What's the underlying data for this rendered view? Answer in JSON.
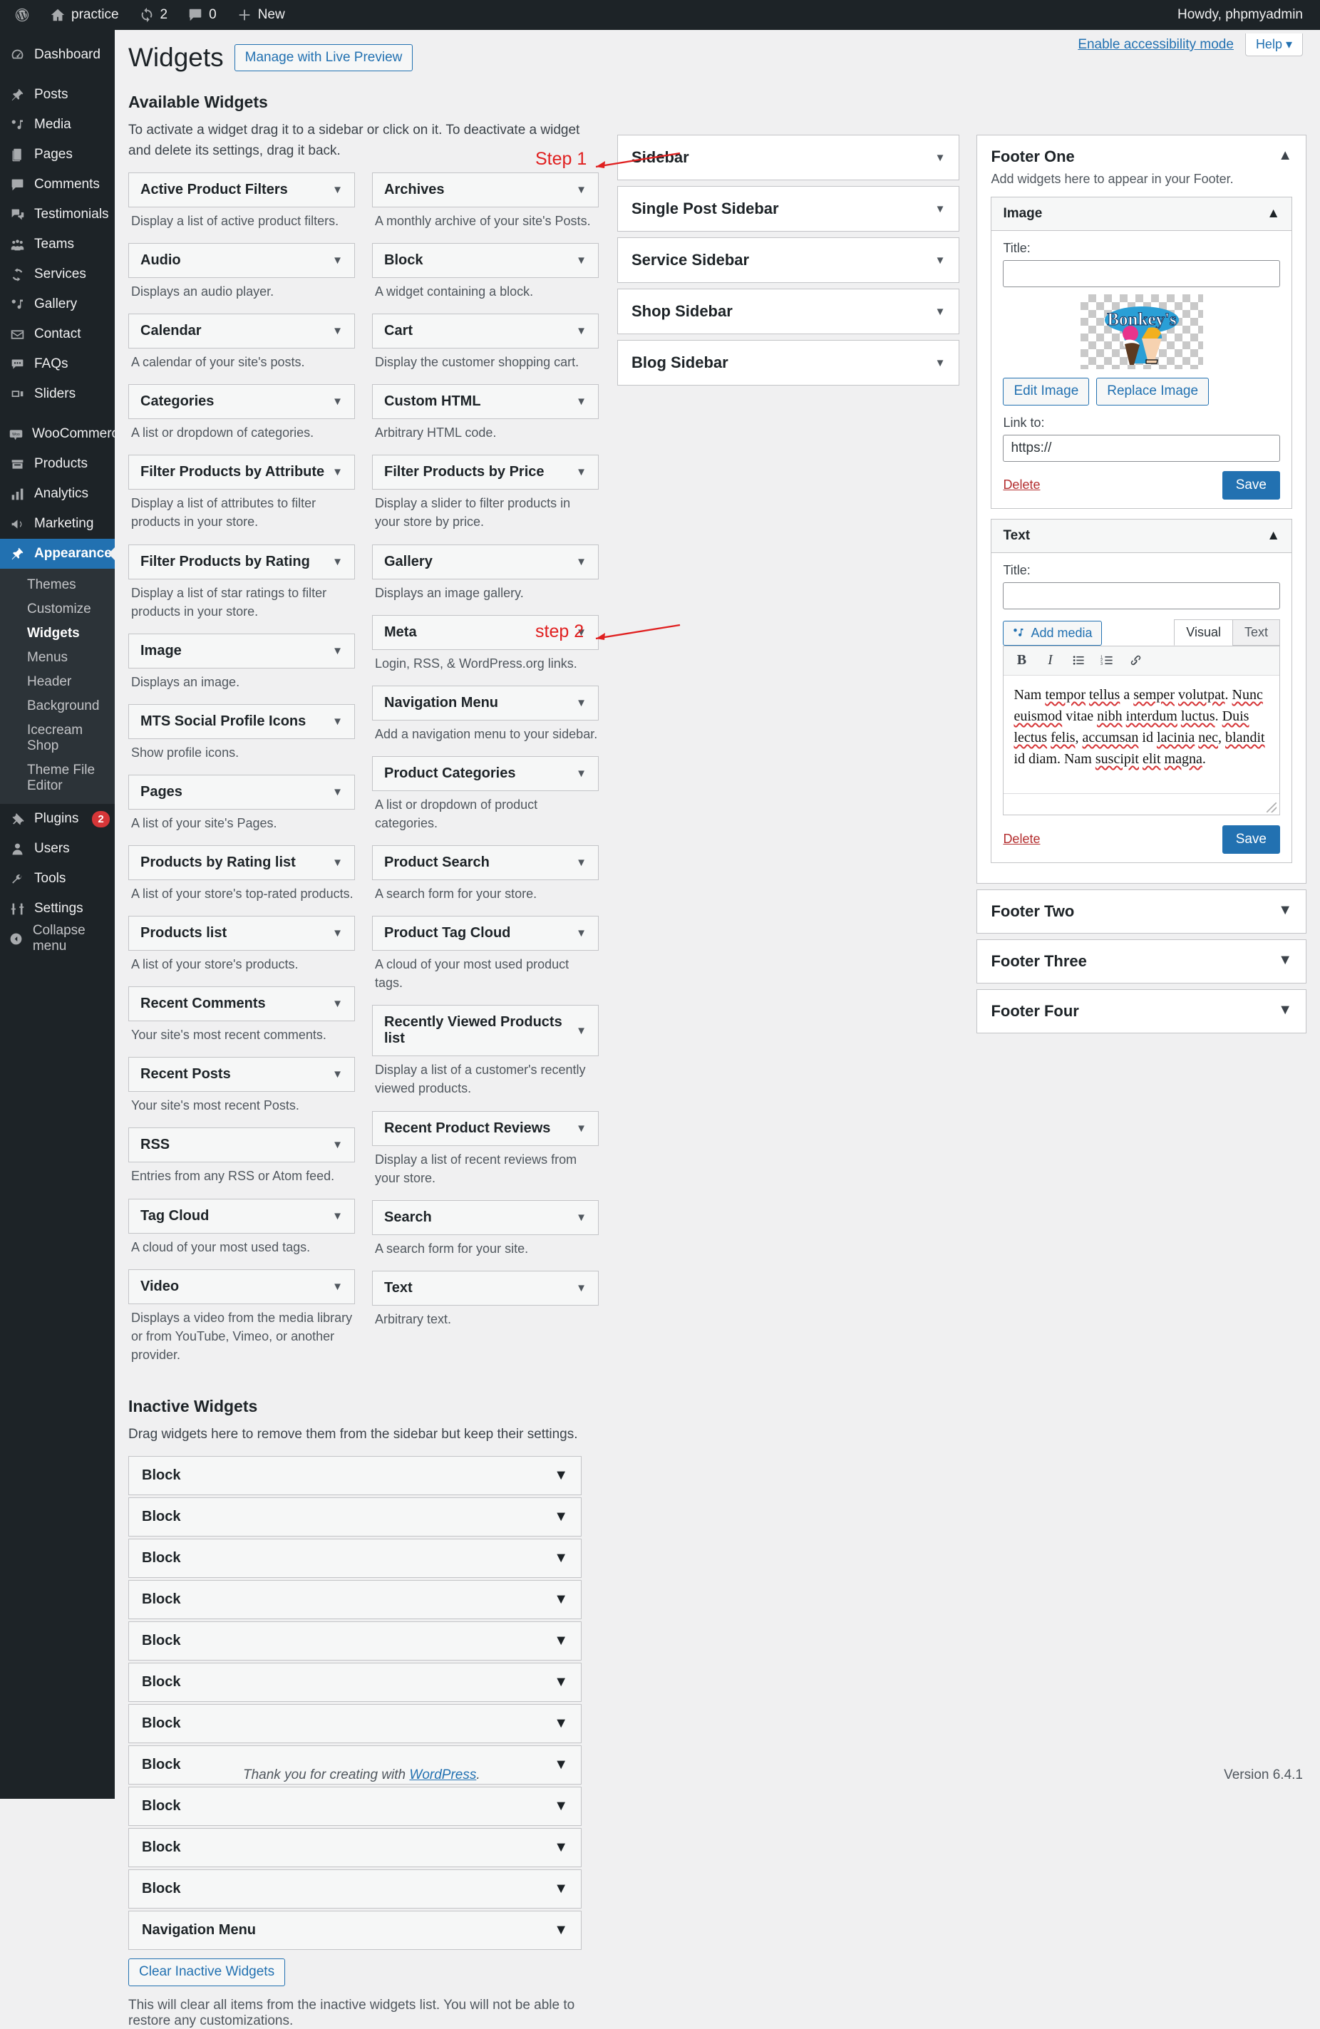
{
  "adminbar": {
    "logo_icon": "wordpress-icon",
    "site_icon": "home-icon",
    "site_name": "practice",
    "updates_icon": "updates-icon",
    "updates_count": "2",
    "comments_icon": "comment-icon",
    "comments_count": "0",
    "new_icon": "plus-icon",
    "new_label": "New",
    "howdy": "Howdy, phpmyadmin"
  },
  "adminmenu": {
    "items": [
      {
        "label": "Dashboard",
        "icon": "dashboard-icon"
      },
      {
        "label": "Posts",
        "icon": "pin-icon"
      },
      {
        "label": "Media",
        "icon": "media-icon"
      },
      {
        "label": "Pages",
        "icon": "pages-icon"
      },
      {
        "label": "Comments",
        "icon": "comment-icon"
      },
      {
        "label": "Testimonials",
        "icon": "testimonial-icon"
      },
      {
        "label": "Teams",
        "icon": "teams-icon"
      },
      {
        "label": "Services",
        "icon": "services-icon"
      },
      {
        "label": "Gallery",
        "icon": "gallery-icon"
      },
      {
        "label": "Contact",
        "icon": "envelope-icon"
      },
      {
        "label": "FAQs",
        "icon": "faq-icon"
      },
      {
        "label": "Sliders",
        "icon": "sliders-icon"
      },
      {
        "label": "WooCommerce",
        "icon": "woocommerce-icon"
      },
      {
        "label": "Products",
        "icon": "products-icon"
      },
      {
        "label": "Analytics",
        "icon": "analytics-icon"
      },
      {
        "label": "Marketing",
        "icon": "marketing-icon"
      },
      {
        "label": "Appearance",
        "icon": "appearance-icon"
      }
    ],
    "appearance_submenu": [
      "Themes",
      "Customize",
      "Widgets",
      "Menus",
      "Header",
      "Background",
      "Icecream Shop",
      "Theme File Editor"
    ],
    "appearance_active_sub": "Widgets",
    "plugins": {
      "label": "Plugins",
      "icon": "plugins-icon",
      "badge": "2"
    },
    "users": {
      "label": "Users",
      "icon": "users-icon"
    },
    "tools": {
      "label": "Tools",
      "icon": "tools-icon"
    },
    "settings": {
      "label": "Settings",
      "icon": "settings-icon"
    },
    "collapse": {
      "label": "Collapse menu",
      "icon": "collapse-icon"
    }
  },
  "topbar": {
    "accessibility_link": "Enable accessibility mode",
    "help_label": "Help ▾"
  },
  "page": {
    "title": "Widgets",
    "live_preview_button": "Manage with Live Preview",
    "available_heading": "Available Widgets",
    "available_desc": "To activate a widget drag it to a sidebar or click on it. To deactivate a widget and delete its settings, drag it back.",
    "inactive_heading": "Inactive Widgets",
    "inactive_desc": "Drag widgets here to remove them from the sidebar but keep their settings.",
    "clear_button": "Clear Inactive Widgets",
    "clear_note": "This will clear all items from the inactive widgets list. You will not be able to restore any customizations.",
    "credit_prefix": "Thank you for creating with ",
    "credit_link": "WordPress",
    "credit_suffix": ".",
    "version": "Version 6.4.1"
  },
  "available_widgets": {
    "column_left": [
      {
        "name": "Active Product Filters",
        "desc": "Display a list of active product filters."
      },
      {
        "name": "Audio",
        "desc": "Displays an audio player."
      },
      {
        "name": "Calendar",
        "desc": "A calendar of your site's posts."
      },
      {
        "name": "Categories",
        "desc": "A list or dropdown of categories."
      },
      {
        "name": "Filter Products by Attribute",
        "desc": "Display a list of attributes to filter products in your store."
      },
      {
        "name": "Filter Products by Rating",
        "desc": "Display a list of star ratings to filter products in your store."
      },
      {
        "name": "Image",
        "desc": "Displays an image."
      },
      {
        "name": "MTS Social Profile Icons",
        "desc": "Show profile icons."
      },
      {
        "name": "Pages",
        "desc": "A list of your site's Pages."
      },
      {
        "name": "Products by Rating list",
        "desc": "A list of your store's top-rated products."
      },
      {
        "name": "Products list",
        "desc": "A list of your store's products."
      },
      {
        "name": "Recent Comments",
        "desc": "Your site's most recent comments."
      },
      {
        "name": "Recent Posts",
        "desc": "Your site's most recent Posts."
      },
      {
        "name": "RSS",
        "desc": "Entries from any RSS or Atom feed."
      },
      {
        "name": "Tag Cloud",
        "desc": "A cloud of your most used tags."
      },
      {
        "name": "Video",
        "desc": "Displays a video from the media library or from YouTube, Vimeo, or another provider."
      }
    ],
    "column_right": [
      {
        "name": "Archives",
        "desc": "A monthly archive of your site's Posts."
      },
      {
        "name": "Block",
        "desc": "A widget containing a block."
      },
      {
        "name": "Cart",
        "desc": "Display the customer shopping cart."
      },
      {
        "name": "Custom HTML",
        "desc": "Arbitrary HTML code."
      },
      {
        "name": "Filter Products by Price",
        "desc": "Display a slider to filter products in your store by price."
      },
      {
        "name": "Gallery",
        "desc": "Displays an image gallery."
      },
      {
        "name": "Meta",
        "desc": "Login, RSS, & WordPress.org links."
      },
      {
        "name": "Navigation Menu",
        "desc": "Add a navigation menu to your sidebar."
      },
      {
        "name": "Product Categories",
        "desc": "A list or dropdown of product categories."
      },
      {
        "name": "Product Search",
        "desc": "A search form for your store."
      },
      {
        "name": "Product Tag Cloud",
        "desc": "A cloud of your most used product tags."
      },
      {
        "name": "Recently Viewed Products list",
        "desc": "Display a list of a customer's recently viewed products."
      },
      {
        "name": "Recent Product Reviews",
        "desc": "Display a list of recent reviews from your store."
      },
      {
        "name": "Search",
        "desc": "A search form for your site."
      },
      {
        "name": "Text",
        "desc": "Arbitrary text."
      }
    ]
  },
  "sidebar_panels": [
    {
      "title": "Sidebar"
    },
    {
      "title": "Single Post Sidebar"
    },
    {
      "title": "Service Sidebar"
    },
    {
      "title": "Shop Sidebar"
    },
    {
      "title": "Blog Sidebar"
    }
  ],
  "footer_panels": {
    "footer_one": {
      "title": "Footer One",
      "desc": "Add widgets here to appear in your Footer.",
      "image_widget": {
        "heading": "Image",
        "title_label": "Title:",
        "title_value": "",
        "image_alt": "Bonkey's ice cream logo",
        "image_text": "Bonkey's",
        "edit_button": "Edit Image",
        "replace_button": "Replace Image",
        "link_label": "Link to:",
        "link_value": "https://",
        "delete_label": "Delete",
        "save_label": "Save"
      },
      "text_widget": {
        "heading": "Text",
        "title_label": "Title:",
        "title_value": "",
        "add_media": "Add media",
        "tab_visual": "Visual",
        "tab_text": "Text",
        "toolbar": [
          "bold-icon",
          "italic-icon",
          "bulleted-list-icon",
          "numbered-list-icon",
          "link-icon"
        ],
        "content": "Nam tempor tellus a semper volutpat. Nunc euismod vitae nibh interdum luctus. Duis lectus felis, accumsan id lacinia nec, blandit id diam. Nam suscipit elit magna.",
        "delete_label": "Delete",
        "save_label": "Save"
      }
    },
    "collapsed": [
      {
        "title": "Footer Two"
      },
      {
        "title": "Footer Three"
      },
      {
        "title": "Footer Four"
      }
    ]
  },
  "inactive_widgets": [
    "Block",
    "Block",
    "Block",
    "Block",
    "Block",
    "Block",
    "Block",
    "Block",
    "Block",
    "Block",
    "Block",
    "Navigation Menu"
  ],
  "annotations": [
    {
      "text": "Step 1"
    },
    {
      "text": "step 2"
    }
  ],
  "colors": {
    "accent": "#2271b1",
    "admin_bg": "#1d2327",
    "annotation": "#e02020",
    "danger": "#b32d2e"
  }
}
